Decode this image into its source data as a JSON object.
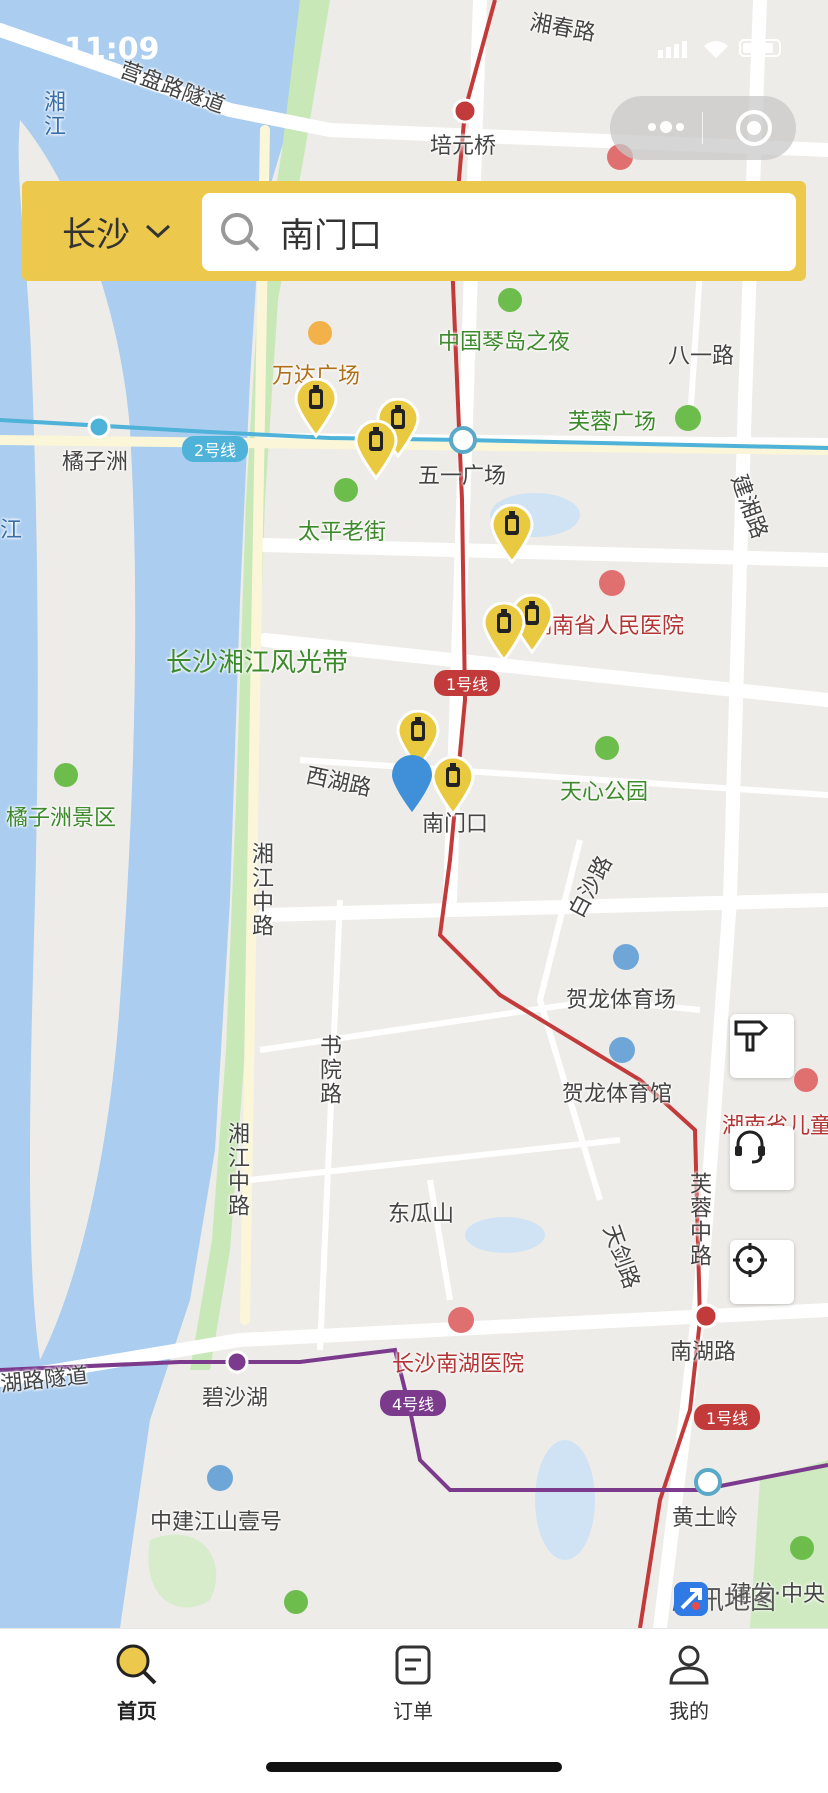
{
  "status_bar": {
    "time": "11:09"
  },
  "search": {
    "city": "长沙",
    "query": "南门口"
  },
  "map": {
    "labels": {
      "road_xiangchun": "湘春路",
      "tunnel_yingpan": "营盘路隧道",
      "station_peiyuanqiao": "培元桥",
      "zhongguo_qindao": "中国琴岛之夜",
      "wanda": "万达广场",
      "bayi_road": "八一路",
      "furong_square": "芙蓉广场",
      "juzizhou": "橘子洲",
      "line2": "2号线",
      "wuyi_square": "五一广场",
      "taiping_street": "太平老街",
      "jianxiang_road": "建湘路",
      "hospital_people": "湖南省人民医院",
      "xiangjiang_belt": "长沙湘江风光带",
      "line1": "1号线",
      "xihu_road": "西湖路",
      "tianxin_park": "天心公园",
      "nanmenkou": "南门口",
      "juzizhou_scenic": "橘子洲景区",
      "xiangjiang_middle": "湘江中路",
      "baisha_road": "白沙路",
      "helong_stadium": "贺龙体育场",
      "shuyuan_road": "书院路",
      "helong_gym": "贺龙体育馆",
      "child_hospital": "湖南省儿童",
      "xiangjiang_middle2": "湘江中路",
      "dongguashan": "东瓜山",
      "tianjian_road": "天剑路",
      "furong_middle": "芙蓉中路",
      "nanhu_road": "南湖路",
      "nanhu_hospital": "长沙南湖医院",
      "tunnel_nanhu": "湖路隧道",
      "bishahu": "碧沙湖",
      "line4": "4号线",
      "zhongjian": "中建江山壹号",
      "huangtuling": "黄土岭",
      "jianfa": "建发·中央",
      "xiang_river": "湘江",
      "xiang_river2": "江"
    },
    "pin_count": 8,
    "watermark": "腾讯地图"
  },
  "tabs": [
    {
      "label": "首页",
      "active": true
    },
    {
      "label": "订单",
      "active": false
    },
    {
      "label": "我的",
      "active": false
    }
  ],
  "colors": {
    "accent": "#ecc94c",
    "metro_line1": "#c23a3a",
    "metro_line2": "#4fb2d8",
    "metro_line4": "#7b3a8c",
    "river": "#aacdf0",
    "greenbelt": "#c9e8b8"
  }
}
